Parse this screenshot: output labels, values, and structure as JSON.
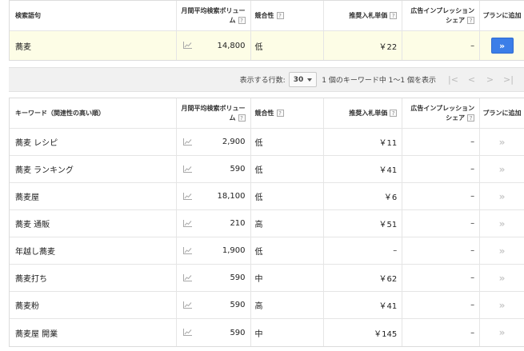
{
  "headers": {
    "query_keyword": "検索語句",
    "ideas_keyword": "キーワード（関連性の高い順）",
    "volume_line1": "月間平均検索ボリュー",
    "volume_line2": "ム",
    "competition": "競合性",
    "bid": "推奨入札単価",
    "share_line1": "広告インプレッション",
    "share_line2": "シェア",
    "add": "プランに追加",
    "help": "?"
  },
  "query_row": {
    "keyword": "蕎麦",
    "volume": "14,800",
    "competition": "低",
    "bid": "￥22",
    "share": "–",
    "add": "»"
  },
  "pagination": {
    "rows_label": "表示する行数:",
    "rows_value": "30",
    "summary": "1 個のキーワード中 1〜1 個を表示",
    "first": "|<",
    "prev": "<",
    "next": ">",
    "last": ">|"
  },
  "ideas": [
    {
      "keyword": "蕎麦 レシピ",
      "volume": "2,900",
      "competition": "低",
      "bid": "￥11",
      "share": "–",
      "add": "»"
    },
    {
      "keyword": "蕎麦 ランキング",
      "volume": "590",
      "competition": "低",
      "bid": "￥41",
      "share": "–",
      "add": "»"
    },
    {
      "keyword": "蕎麦屋",
      "volume": "18,100",
      "competition": "低",
      "bid": "￥6",
      "share": "–",
      "add": "»"
    },
    {
      "keyword": "蕎麦 通販",
      "volume": "210",
      "competition": "高",
      "bid": "￥51",
      "share": "–",
      "add": "»"
    },
    {
      "keyword": "年越し蕎麦",
      "volume": "1,900",
      "competition": "低",
      "bid": "–",
      "share": "–",
      "add": "»"
    },
    {
      "keyword": "蕎麦打ち",
      "volume": "590",
      "competition": "中",
      "bid": "￥62",
      "share": "–",
      "add": "»"
    },
    {
      "keyword": "蕎麦粉",
      "volume": "590",
      "competition": "高",
      "bid": "￥41",
      "share": "–",
      "add": "»"
    },
    {
      "keyword": "蕎麦屋 開業",
      "volume": "590",
      "competition": "中",
      "bid": "￥145",
      "share": "–",
      "add": "»"
    }
  ],
  "icons": {
    "trend": "trend-chart-icon",
    "add": "double-chevron-right-icon"
  },
  "colors": {
    "highlight_row": "#fdfde6",
    "add_button": "#3b7ee8",
    "pager_bg": "#f1f1f1"
  }
}
